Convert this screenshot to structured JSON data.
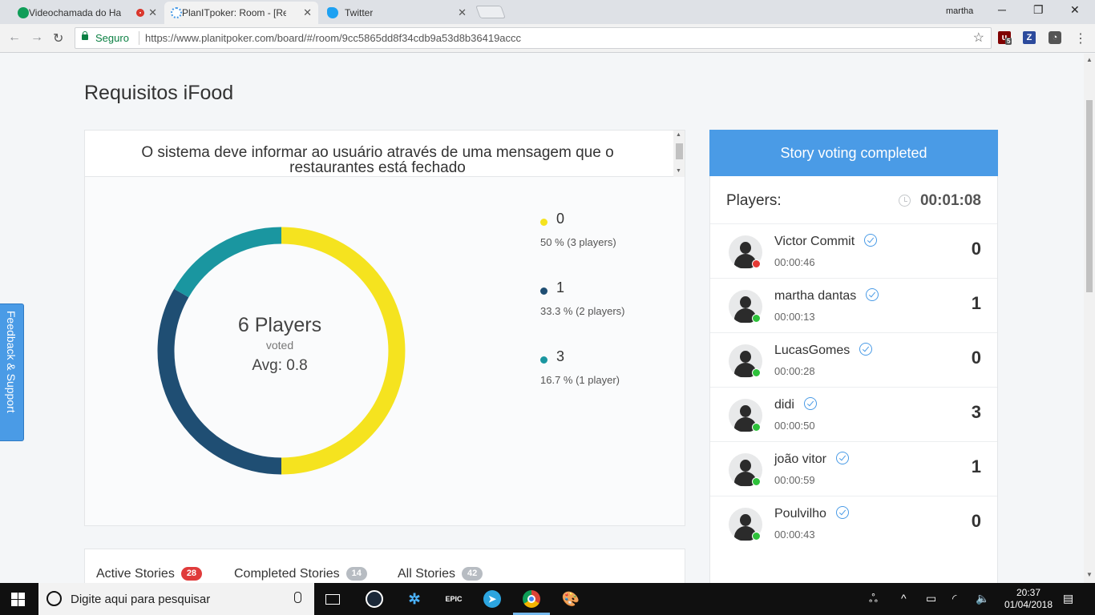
{
  "browser": {
    "tabs": [
      {
        "title": "Videochamada do Ha",
        "favicon_color": "#0f9d58",
        "recording": true
      },
      {
        "title": "PlanITpoker: Room - [Rec",
        "favicon_color": "#4a9be6",
        "active": true
      },
      {
        "title": "Twitter",
        "favicon_color": "#1da1f2"
      }
    ],
    "profile_name": "martha",
    "secure_label": "Seguro",
    "url": "https://www.planitpoker.com/board/#/room/9cc5865dd8f34cdb9a53d8b36419accc",
    "extension_badge": "5",
    "extension_z": "Z"
  },
  "room": {
    "title": "Requisitos iFood"
  },
  "story": {
    "text": "O sistema deve informar ao usuário através de uma mensagem que o restaurantes está fechado"
  },
  "results": {
    "players_label": "6 Players",
    "voted_label": "voted",
    "avg_label": "Avg: 0.8",
    "legend": [
      {
        "value": "0",
        "pct": "50 % (3 players)",
        "color": "#f5e31f",
        "share": 0.5
      },
      {
        "value": "1",
        "pct": "33.3 % (2 players)",
        "color": "#1f4e73",
        "share": 0.3333
      },
      {
        "value": "3",
        "pct": "16.7 % (1 player)",
        "color": "#1a96a0",
        "share": 0.1667
      }
    ]
  },
  "story_tabs": [
    {
      "label": "Active Stories",
      "count": "28",
      "color": "#e03b3b"
    },
    {
      "label": "Completed Stories",
      "count": "14",
      "color": "#b7bcc2"
    },
    {
      "label": "All Stories",
      "count": "42",
      "color": "#b7bcc2"
    }
  ],
  "panel": {
    "status": "Story voting completed",
    "players_label": "Players:",
    "timer": "00:01:08",
    "players": [
      {
        "name": "Victor Commit",
        "time": "00:00:46",
        "vote": "0",
        "status_color": "#e53935"
      },
      {
        "name": "martha dantas",
        "time": "00:00:13",
        "vote": "1",
        "status_color": "#2ec13b"
      },
      {
        "name": "LucasGomes",
        "time": "00:00:28",
        "vote": "0",
        "status_color": "#2ec13b"
      },
      {
        "name": "didi",
        "time": "00:00:50",
        "vote": "3",
        "status_color": "#2ec13b"
      },
      {
        "name": "joão vitor",
        "time": "00:00:59",
        "vote": "1",
        "status_color": "#2ec13b"
      },
      {
        "name": "Poulvilho",
        "time": "00:00:43",
        "vote": "0",
        "status_color": "#2ec13b"
      }
    ]
  },
  "feedback": {
    "label": "Feedback & Support"
  },
  "taskbar": {
    "search_placeholder": "Digite aqui para pesquisar",
    "epic_label": "EPIC",
    "time": "20:37",
    "date": "01/04/2018"
  }
}
